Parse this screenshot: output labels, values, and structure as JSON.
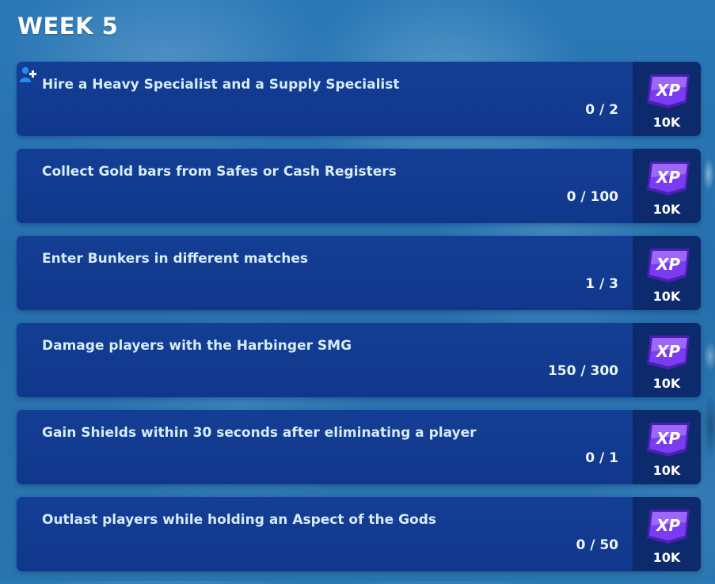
{
  "header": {
    "title": "WEEK 5"
  },
  "quests": [
    {
      "title": "Hire a Heavy Specialist and a Supply Specialist",
      "progress": "0 / 2",
      "reward_icon": "xp-badge-icon",
      "reward": "10K",
      "tag_icon": "party-assist-icon"
    },
    {
      "title": "Collect Gold bars from Safes or Cash Registers",
      "progress": "0 / 100",
      "reward_icon": "xp-badge-icon",
      "reward": "10K"
    },
    {
      "title": "Enter Bunkers in different matches",
      "progress": "1 / 3",
      "reward_icon": "xp-badge-icon",
      "reward": "10K"
    },
    {
      "title": "Damage players with the Harbinger SMG",
      "progress": "150 / 300",
      "reward_icon": "xp-badge-icon",
      "reward": "10K"
    },
    {
      "title": "Gain Shields within 30 seconds after eliminating a player",
      "progress": "0 / 1",
      "reward_icon": "xp-badge-icon",
      "reward": "10K"
    },
    {
      "title": "Outlast players while holding an Aspect of the Gods",
      "progress": "0 / 50",
      "reward_icon": "xp-badge-icon",
      "reward": "10K"
    }
  ],
  "xp_badge": {
    "label": "XP",
    "colors": {
      "light": "#b98cff",
      "mid": "#7a3cf0",
      "dark": "#4a1fb5",
      "text": "#ffffff"
    }
  },
  "colors": {
    "background": "#2870ae",
    "card": "#12398f",
    "reward_panel": "#0c2a6c",
    "title_text": "#d6ecfb"
  }
}
